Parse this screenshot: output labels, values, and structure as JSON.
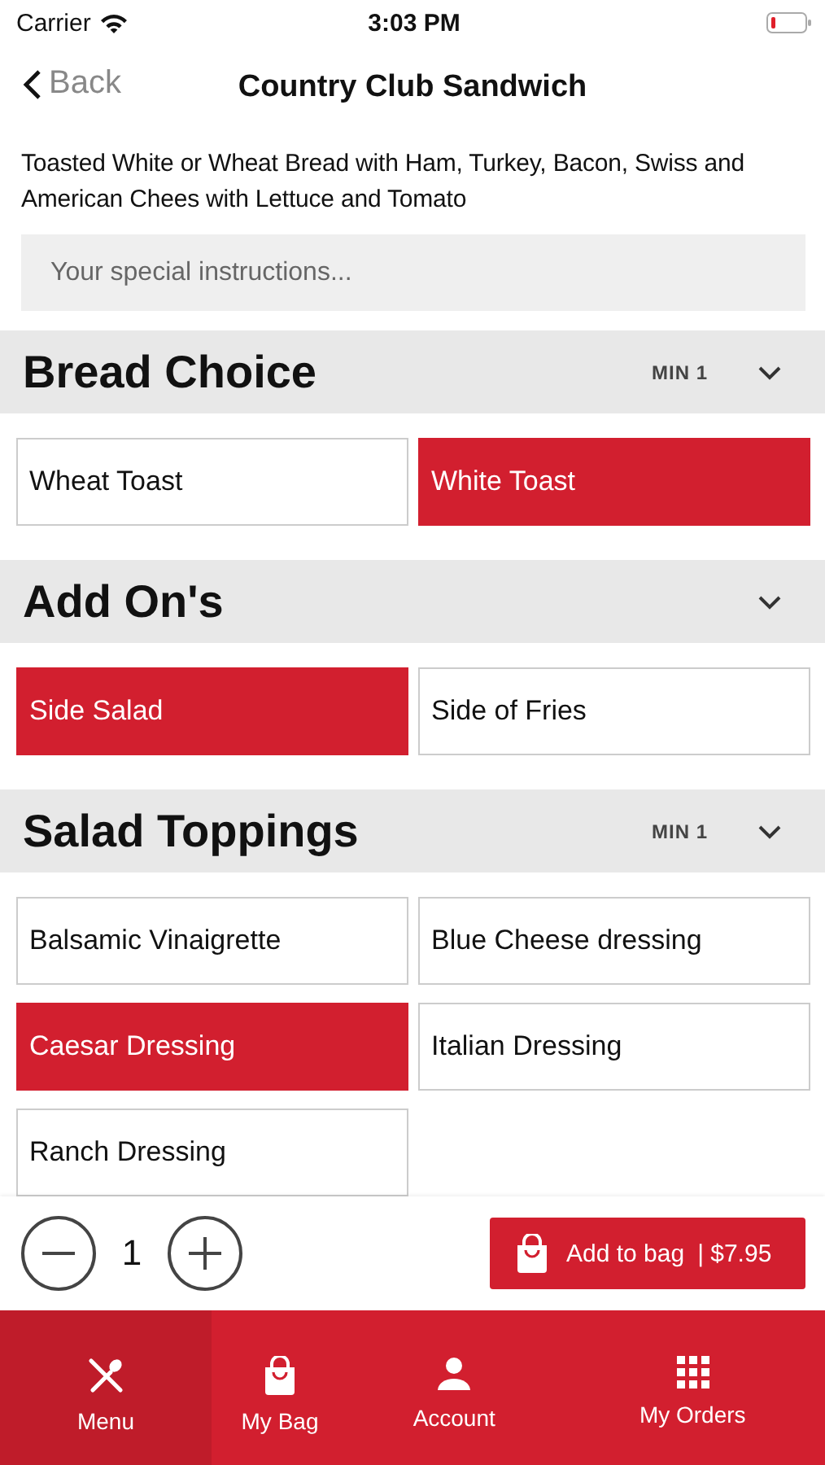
{
  "status_bar": {
    "carrier": "Carrier",
    "time": "3:03 PM"
  },
  "nav": {
    "back": "Back",
    "title": "Country Club Sandwich"
  },
  "description": "Toasted White or Wheat Bread with Ham, Turkey, Bacon, Swiss and American Chees with Lettuce and Tomato",
  "instructions": {
    "placeholder": "Your special instructions..."
  },
  "sections": [
    {
      "title": "Bread Choice",
      "min": "MIN 1",
      "expanded": true,
      "options": [
        {
          "label": "Wheat Toast",
          "selected": false
        },
        {
          "label": "White Toast",
          "selected": true
        }
      ]
    },
    {
      "title": "Add On's",
      "expanded": true,
      "options": [
        {
          "label": "Side Salad",
          "selected": true
        },
        {
          "label": "Side of Fries",
          "selected": false
        }
      ]
    },
    {
      "title": "Salad Toppings",
      "min": "MIN 1",
      "expanded": true,
      "options": [
        {
          "label": "Balsamic Vinaigrette",
          "selected": false
        },
        {
          "label": "Blue Cheese dressing",
          "selected": false
        },
        {
          "label": "Caesar Dressing",
          "selected": true
        },
        {
          "label": "Italian Dressing",
          "selected": false
        },
        {
          "label": "Ranch Dressing",
          "selected": false
        }
      ]
    }
  ],
  "quantity": "1",
  "add_button": {
    "label": "Add to bag",
    "price": "| $7.95"
  },
  "tabs": [
    {
      "label": "Menu",
      "selected": true
    },
    {
      "label": "My Bag",
      "selected": false
    },
    {
      "label": "Account",
      "selected": false
    },
    {
      "label": "My Orders",
      "selected": false
    }
  ]
}
